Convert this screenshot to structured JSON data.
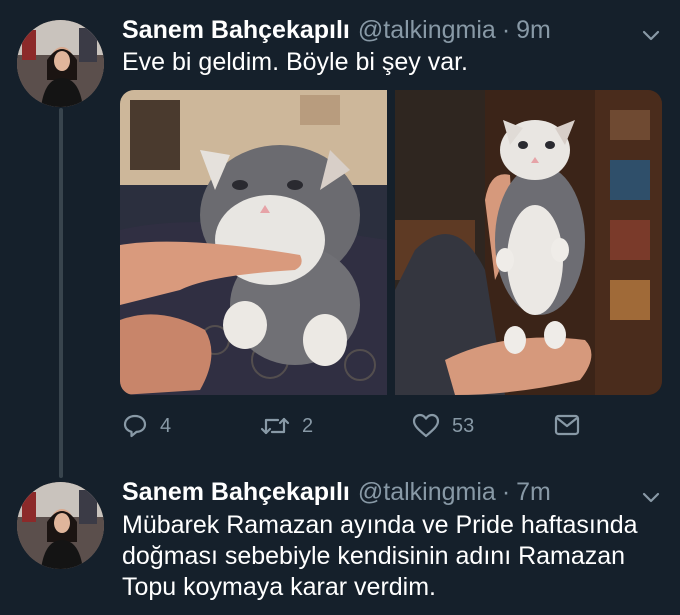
{
  "tweets": [
    {
      "name": "Sanem Bahçekapılı",
      "handle": "@talkingmia",
      "separator": "·",
      "time": "9m",
      "text": "Eve bi geldim. Böyle bi şey var.",
      "media": [
        {
          "kind": "photo",
          "subject": "gray-white kitten held by fingers on blanket"
        },
        {
          "kind": "photo",
          "subject": "gray-white kitten standing in palm"
        }
      ],
      "actions": {
        "reply_count": "4",
        "retweet_count": "2",
        "like_count": "53"
      }
    },
    {
      "name": "Sanem Bahçekapılı",
      "handle": "@talkingmia",
      "separator": "·",
      "time": "7m",
      "text_lines": [
        "Mübarek Ramazan ayında ve Pride haftasında",
        "doğması sebebiyle kendisinin adını Ramazan",
        "Topu koymaya karar verdim."
      ]
    }
  ],
  "colors": {
    "background": "#15202b",
    "text_primary": "#ffffff",
    "text_secondary": "#8899a6",
    "thread_line": "#38444d"
  },
  "icons": [
    "chevron-down-icon",
    "reply-icon",
    "retweet-icon",
    "like-icon",
    "dm-icon"
  ]
}
